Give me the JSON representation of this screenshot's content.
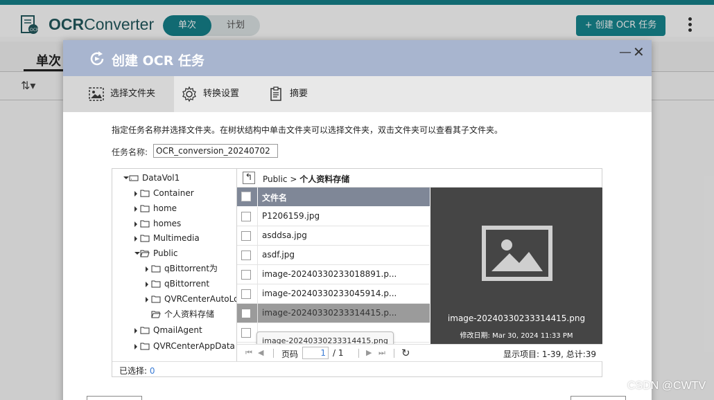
{
  "app": {
    "title_bold": "OCR",
    "title_rest": "Converter",
    "mode_tabs": [
      "单次",
      "计划"
    ],
    "create_button": "+ 创建 OCR 任务",
    "bg_tab": "单次"
  },
  "dialog": {
    "title": "创建 OCR 任务",
    "steps": [
      "选择文件夹",
      "转换设置",
      "摘要"
    ],
    "instruction": "指定任务名称并选择文件夹。在树状结构中单击文件夹可以选择文件夹，双击文件夹可以查看其子文件夹。",
    "task_name_label": "任务名称:",
    "task_name_value": "OCR_conversion_20240702"
  },
  "tree": [
    {
      "label": "DataVol1",
      "expanded": true
    },
    {
      "label": "Container"
    },
    {
      "label": "home"
    },
    {
      "label": "homes"
    },
    {
      "label": "Multimedia"
    },
    {
      "label": "Public",
      "expanded": true
    },
    {
      "label": "qBittorrent为"
    },
    {
      "label": "qBittorrent"
    },
    {
      "label": "QVRCenterAutoLo"
    },
    {
      "label": "个人资料存储",
      "selected": true
    },
    {
      "label": "QmailAgent"
    },
    {
      "label": "QVRCenterAppData"
    }
  ],
  "path": {
    "parent": "Public >",
    "current": "个人资料存储"
  },
  "filelist": {
    "header": "文件名",
    "rows": [
      {
        "name": "P1206159.jpg"
      },
      {
        "name": "asddsa.jpg"
      },
      {
        "name": "asdf.jpg"
      },
      {
        "name": "image-20240330233018891.p..."
      },
      {
        "name": "image-20240330233045914.p..."
      },
      {
        "name": "image-20240330233314415.p...",
        "selected": true
      },
      {
        "name": ""
      }
    ],
    "tooltip": "image-20240330233314415.png"
  },
  "preview": {
    "filename": "image-20240330233314415.png",
    "modified": "修改日期: Mar 30, 2024 11:33 PM"
  },
  "pager": {
    "page_label": "页码",
    "page_value": "1",
    "total": "/ 1",
    "info": "显示项目: 1-39, 总计:39"
  },
  "status": {
    "label": "已选择: ",
    "count": "0"
  },
  "watermark": "CSDN @CWTV",
  "colors": {
    "accent": "#15828c",
    "dialog_header": "#a8b5cf",
    "list_header": "#7f8797",
    "link": "#3a7bd5"
  }
}
